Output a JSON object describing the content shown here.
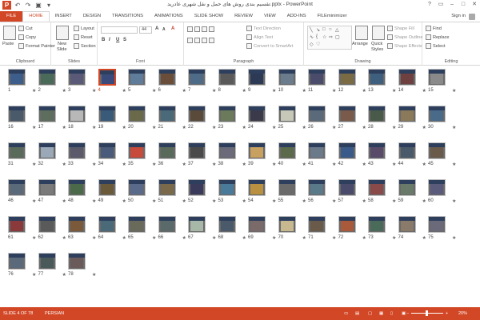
{
  "window": {
    "title": "تقسیم بندی روش های حمل و نقل شهری عادرید.pptx - PowerPoint",
    "app_icon_letter": "P",
    "qat": [
      "↶",
      "↷",
      "▣",
      "▾"
    ],
    "controls": [
      "?",
      "▭",
      "–",
      "□",
      "✕"
    ]
  },
  "tabs": [
    "FILE",
    "HOME",
    "INSERT",
    "DESIGN",
    "TRANSITIONS",
    "ANIMATIONS",
    "SLIDE SHOW",
    "REVIEW",
    "VIEW",
    "ADD-INS",
    "FILEminimizer"
  ],
  "active_tab": "HOME",
  "signin": "Sign in",
  "ribbon": {
    "clipboard": {
      "paste": "Paste",
      "cut": "Cut",
      "copy": "Copy",
      "format_painter": "Format Painter",
      "label": "Clipboard"
    },
    "slides": {
      "new_slide": "New",
      "new_slide2": "Slide",
      "layout": "Layout",
      "reset": "Reset",
      "section": "Section",
      "label": "Slides"
    },
    "font": {
      "size": "44",
      "label": "Font",
      "bold": "B",
      "italic": "I",
      "underline": "U",
      "strike": "S",
      "grow": "A",
      "shrink": "A",
      "clear": "A"
    },
    "paragraph": {
      "text_direction": "Text Direction",
      "align_text": "Align Text",
      "convert": "Convert to SmartArt",
      "label": "Paragraph"
    },
    "drawing": {
      "arrange": "Arrange",
      "quick_styles": "Quick",
      "quick_styles2": "Styles",
      "shape_fill": "Shape Fill",
      "shape_outline": "Shape Outline",
      "shape_effects": "Shape Effects",
      "label": "Drawing"
    },
    "editing": {
      "find": "Find",
      "replace": "Replace",
      "select": "Select",
      "label": "Editing"
    }
  },
  "slides": [
    {
      "n": "1",
      "c": "#3d5e8a"
    },
    {
      "n": "2",
      "c": "#4a6a5a"
    },
    {
      "n": "3",
      "c": "#5a5a78"
    },
    {
      "n": "4",
      "c": "#3a4a7a"
    },
    {
      "n": "5",
      "c": "#5f7d9a"
    },
    {
      "n": "6",
      "c": "#6a4e3a"
    },
    {
      "n": "7",
      "c": "#4e6b88"
    },
    {
      "n": "8",
      "c": "#5a5a5a"
    },
    {
      "n": "9",
      "c": "#2c3a55"
    },
    {
      "n": "10",
      "c": "#6b7c8c"
    },
    {
      "n": "11",
      "c": "#4b4b6b"
    },
    {
      "n": "12",
      "c": "#7a6b45"
    },
    {
      "n": "13",
      "c": "#3f5f7f"
    },
    {
      "n": "14",
      "c": "#6e4040"
    },
    {
      "n": "15",
      "c": "#8a8a8a"
    },
    {
      "n": "16",
      "c": "#4a5a6a"
    },
    {
      "n": "17",
      "c": "#5e6e5e"
    },
    {
      "n": "18",
      "c": "#b8b8b8"
    },
    {
      "n": "19",
      "c": "#3a5a7a"
    },
    {
      "n": "20",
      "c": "#6a6a4a"
    },
    {
      "n": "21",
      "c": "#4a6a7a"
    },
    {
      "n": "22",
      "c": "#5a4a3a"
    },
    {
      "n": "23",
      "c": "#6a7a5a"
    },
    {
      "n": "24",
      "c": "#3a3a4a"
    },
    {
      "n": "25",
      "c": "#c8c8b8"
    },
    {
      "n": "26",
      "c": "#5a6a7a"
    },
    {
      "n": "27",
      "c": "#7a5a4a"
    },
    {
      "n": "28",
      "c": "#4a5a4a"
    },
    {
      "n": "29",
      "c": "#8a7a5a"
    },
    {
      "n": "30",
      "c": "#4a6a8a"
    },
    {
      "n": "31",
      "c": "#5a6a5a"
    },
    {
      "n": "32",
      "c": "#9aa8b8"
    },
    {
      "n": "33",
      "c": "#5a5a6a"
    },
    {
      "n": "34",
      "c": "#4a5a7a"
    },
    {
      "n": "35",
      "c": "#c84a3a"
    },
    {
      "n": "36",
      "c": "#5a6a5a"
    },
    {
      "n": "37",
      "c": "#4a4a4a"
    },
    {
      "n": "38",
      "c": "#6a6a7a"
    },
    {
      "n": "39",
      "c": "#c8a060"
    },
    {
      "n": "40",
      "c": "#5a6a4a"
    },
    {
      "n": "41",
      "c": "#6a7a8a"
    },
    {
      "n": "42",
      "c": "#3a5a8a"
    },
    {
      "n": "43",
      "c": "#5a4a6a"
    },
    {
      "n": "44",
      "c": "#4a5a6a"
    },
    {
      "n": "45",
      "c": "#6a5a4a"
    },
    {
      "n": "46",
      "c": "#5a6a7a"
    },
    {
      "n": "47",
      "c": "#7a7a7a"
    },
    {
      "n": "48",
      "c": "#4a6a4a"
    },
    {
      "n": "49",
      "c": "#6a5a3a"
    },
    {
      "n": "50",
      "c": "#5a6a8a"
    },
    {
      "n": "51",
      "c": "#7a6a4a"
    },
    {
      "n": "52",
      "c": "#3a3a5a"
    },
    {
      "n": "53",
      "c": "#4a7a9a"
    },
    {
      "n": "54",
      "c": "#b89040"
    },
    {
      "n": "55",
      "c": "#6a6a6a"
    },
    {
      "n": "56",
      "c": "#5a7a8a"
    },
    {
      "n": "57",
      "c": "#4a4a6a"
    },
    {
      "n": "58",
      "c": "#8a4a4a"
    },
    {
      "n": "59",
      "c": "#6a7a6a"
    },
    {
      "n": "60",
      "c": "#5a5a7a"
    },
    {
      "n": "61",
      "c": "#8a3a3a"
    },
    {
      "n": "62",
      "c": "#5a5a5a"
    },
    {
      "n": "63",
      "c": "#7a5a3a"
    },
    {
      "n": "64",
      "c": "#4a6a7a"
    },
    {
      "n": "65",
      "c": "#6a6a5a"
    },
    {
      "n": "66",
      "c": "#5a6a6a"
    },
    {
      "n": "67",
      "c": "#a8b8a8"
    },
    {
      "n": "68",
      "c": "#4a5a6a"
    },
    {
      "n": "69",
      "c": "#7a6a6a"
    },
    {
      "n": "70",
      "c": "#c8b890"
    },
    {
      "n": "71",
      "c": "#6a5a4a"
    },
    {
      "n": "72",
      "c": "#a85a3a"
    },
    {
      "n": "73",
      "c": "#4a6a5a"
    },
    {
      "n": "74",
      "c": "#8a7a6a"
    },
    {
      "n": "75",
      "c": "#6a6a7a"
    },
    {
      "n": "76",
      "c": "#5a6a7a"
    },
    {
      "n": "77",
      "c": "#4a5a5a"
    },
    {
      "n": "78",
      "c": "#6a5a5a"
    }
  ],
  "selected_slide": "4",
  "status": {
    "slide": "SLIDE 4 OF 78",
    "lang": "PERSIAN",
    "zoom": "20%",
    "minus": "–",
    "plus": "+"
  }
}
